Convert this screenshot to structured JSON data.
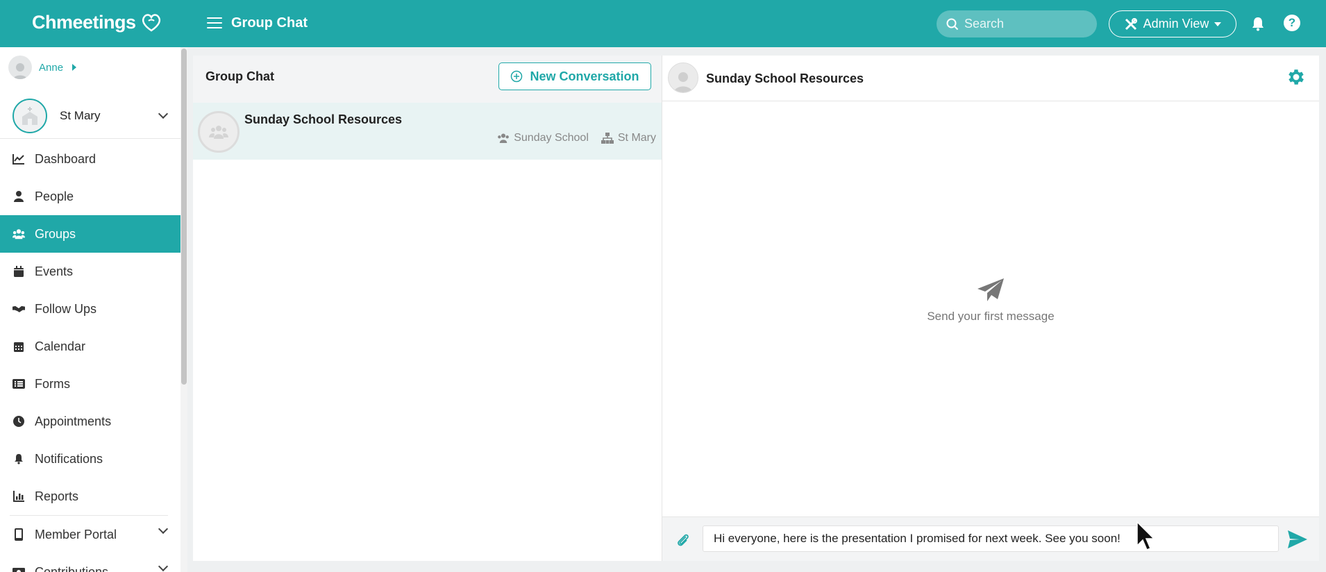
{
  "app": {
    "logo_text": "Chmeetings",
    "page_title": "Group Chat"
  },
  "topbar": {
    "search_placeholder": "Search",
    "admin_view_label": "Admin View",
    "help_label": "?"
  },
  "sidebar": {
    "user_name": "Anne",
    "church_name": "St Mary",
    "items": [
      {
        "label": "Dashboard",
        "icon": "chart-line-icon",
        "active": false
      },
      {
        "label": "People",
        "icon": "person-icon",
        "active": false
      },
      {
        "label": "Groups",
        "icon": "users-icon",
        "active": true
      },
      {
        "label": "Events",
        "icon": "calendar-icon",
        "active": false
      },
      {
        "label": "Follow Ups",
        "icon": "handshake-icon",
        "active": false
      },
      {
        "label": "Calendar",
        "icon": "calendar-grid-icon",
        "active": false
      },
      {
        "label": "Forms",
        "icon": "list-icon",
        "active": false
      },
      {
        "label": "Appointments",
        "icon": "clock-icon",
        "active": false
      },
      {
        "label": "Notifications",
        "icon": "bell-icon",
        "active": false
      },
      {
        "label": "Reports",
        "icon": "bar-chart-icon",
        "active": false
      },
      {
        "label": "Member Portal",
        "icon": "mobile-icon",
        "active": false
      },
      {
        "label": "Contributions",
        "icon": "money-icon",
        "active": false
      }
    ]
  },
  "conversations": {
    "title": "Group Chat",
    "new_button_label": "New Conversation",
    "items": [
      {
        "name": "Sunday School Resources",
        "group": "Sunday School",
        "campus": "St Mary"
      }
    ]
  },
  "chat": {
    "title": "Sunday School Resources",
    "empty_message": "Send your first message",
    "composer_value": "Hi everyone, here is the presentation I promised for next week. See you soon!"
  },
  "colors": {
    "brand": "#20a8a8",
    "active_row": "#e8f3f3"
  }
}
